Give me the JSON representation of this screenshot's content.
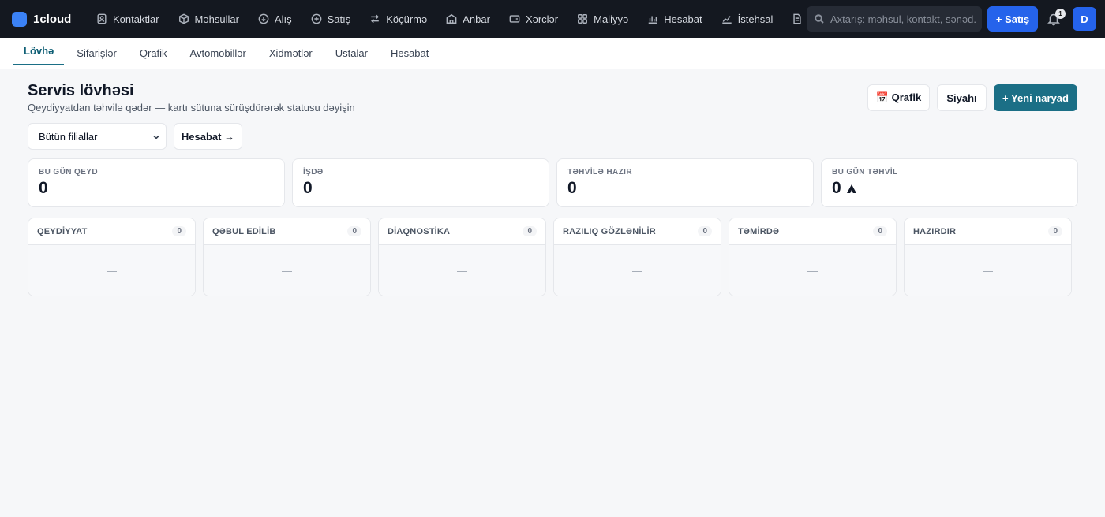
{
  "brand": {
    "name": "1cloud",
    "color": "#3b82f6"
  },
  "nav": {
    "items": [
      {
        "label": "Kontaktlar",
        "icon": "contacts-icon"
      },
      {
        "label": "Məhsullar",
        "icon": "box-icon"
      },
      {
        "label": "Alış",
        "icon": "download-circle-icon"
      },
      {
        "label": "Satış",
        "icon": "plus-circle-icon"
      },
      {
        "label": "Köçürmə",
        "icon": "swap-icon"
      },
      {
        "label": "Anbar",
        "icon": "warehouse-icon"
      },
      {
        "label": "Xərclər",
        "icon": "wallet-icon"
      },
      {
        "label": "Maliyyə",
        "icon": "grid-icon"
      },
      {
        "label": "Hesabat",
        "icon": "bar-chart-icon"
      },
      {
        "label": "İstehsal",
        "icon": "factory-icon"
      }
    ]
  },
  "search": {
    "placeholder": "Axtarış: məhsul, kontakt, sənəd..."
  },
  "header_actions": {
    "sale_label": "+ Satış",
    "notifications_count": "1",
    "avatar_initial": "D"
  },
  "subtabs": [
    "Lövhə",
    "Sifarişlər",
    "Qrafik",
    "Avtomobillər",
    "Xidmətlər",
    "Ustalar",
    "Hesabat"
  ],
  "page": {
    "title": "Servis lövhəsi",
    "subtitle": "Qeydiyyatdan təhvilə qədər — kartı sütuna sürüşdürərək statusu dəyişin",
    "schedule_button": "📅 Qrafik",
    "list_button": "Siyahı",
    "new_order_button": "+ Yeni naryad"
  },
  "filters": {
    "branch_select": "Bütün filiallar",
    "report_button": "Hesabat →"
  },
  "stats": [
    {
      "label": "BU GÜN QEYD",
      "value": "0"
    },
    {
      "label": "İŞDƏ",
      "value": "0"
    },
    {
      "label": "TƏHVİLƏ HAZIR",
      "value": "0"
    },
    {
      "label": "BU GÜN TƏHVİL",
      "value": "0"
    }
  ],
  "columns": [
    {
      "title": "QEYDİYYAT",
      "count": "0",
      "empty": "—"
    },
    {
      "title": "QƏBUL EDİLİB",
      "count": "0",
      "empty": "—"
    },
    {
      "title": "DİAQNOSTİKA",
      "count": "0",
      "empty": "—"
    },
    {
      "title": "RAZILIQ GÖZLƏNİLİR",
      "count": "0",
      "empty": "—"
    },
    {
      "title": "TƏMİRDƏ",
      "count": "0",
      "empty": "—"
    },
    {
      "title": "HAZIRDIR",
      "count": "0",
      "empty": "—"
    }
  ],
  "colors": {
    "topbar": "#141820",
    "accent_blue": "#2563eb",
    "teal": "#1b6f86"
  }
}
